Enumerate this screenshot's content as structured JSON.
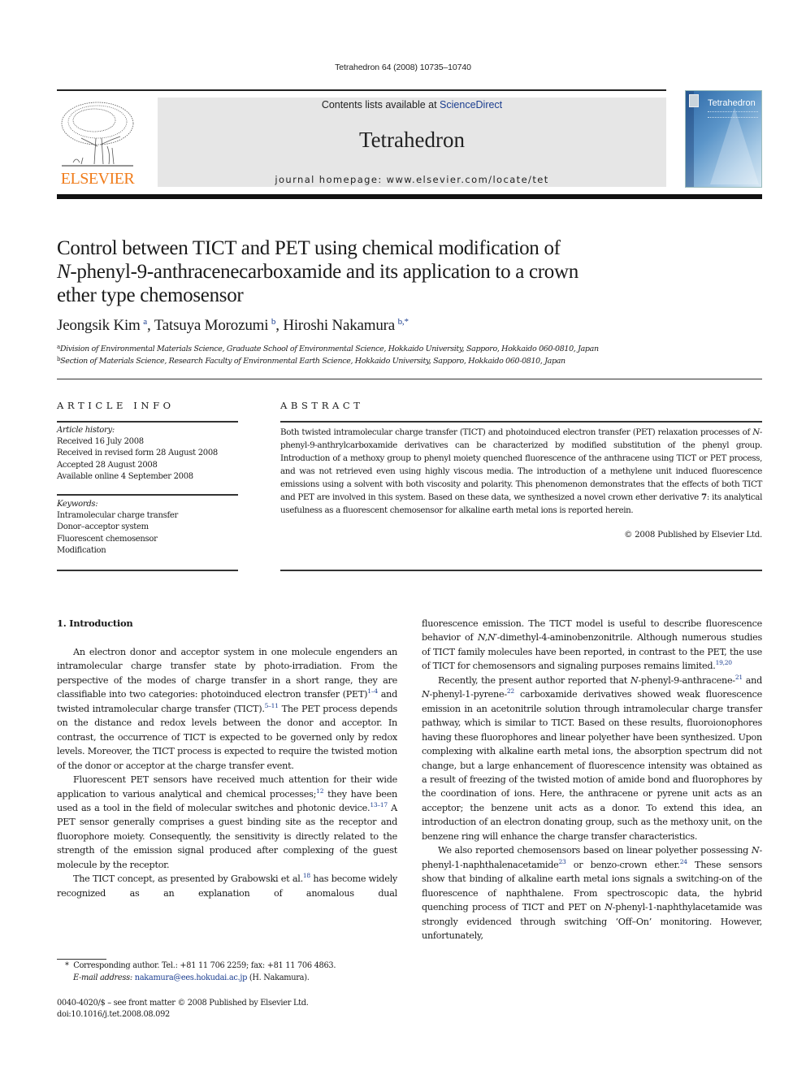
{
  "header": {
    "citation": "Tetrahedron 64 (2008) 10735–10740",
    "publisher_logo_text": "ELSEVIER",
    "contents_prefix": "Contents lists available at ",
    "contents_link": "ScienceDirect",
    "journal_title": "Tetrahedron",
    "homepage": "journal homepage: www.elsevier.com/locate/tet",
    "cover_title": "Tetrahedron"
  },
  "article": {
    "title_line1": "Control between TICT and PET using chemical modification of",
    "title_line2_italic": "N",
    "title_line2_rest": "-phenyl-9-anthracenecarboxamide and its application to a crown",
    "title_line3": "ether type chemosensor",
    "authors": [
      {
        "name": "Jeongsik Kim",
        "sup": "a"
      },
      {
        "name": "Tatsuya Morozumi",
        "sup": "b"
      },
      {
        "name": "Hiroshi Nakamura",
        "sup": "b,*"
      }
    ],
    "affiliations": [
      {
        "mark": "a",
        "text": "Division of Environmental Materials Science, Graduate School of Environmental Science, Hokkaido University, Sapporo, Hokkaido 060-0810, Japan"
      },
      {
        "mark": "b",
        "text": "Section of Materials Science, Research Faculty of Environmental Earth Science, Hokkaido University, Sapporo, Hokkaido 060-0810, Japan"
      }
    ]
  },
  "article_info": {
    "heading": "ARTICLE INFO",
    "history_label": "Article history:",
    "history": [
      "Received 16 July 2008",
      "Received in revised form 28 August 2008",
      "Accepted 28 August 2008",
      "Available online 4 September 2008"
    ],
    "keywords_label": "Keywords:",
    "keywords": [
      "Intramolecular charge transfer",
      "Donor–acceptor system",
      "Fluorescent chemosensor",
      "Modification"
    ]
  },
  "abstract": {
    "heading": "ABSTRACT",
    "p1": "Both twisted intramolecular charge transfer (TICT) and photoinduced electron transfer (PET) relaxation processes of ",
    "p1_italic": "N",
    "p2": "-phenyl-9-anthrylcarboxamide derivatives can be characterized by modified substitution of the phenyl group. Introduction of a methoxy group to phenyl moiety quenched fluorescence of the anthracene using TICT or PET process, and was not retrieved even using highly viscous media. The introduction of a methylene unit induced fluorescence emissions using a solvent with both viscosity and polarity. This phenomenon demonstrates that the effects of both TICT and PET are involved in this system. Based on these data, we synthesized a novel crown ether derivative ",
    "p2_bold": "7",
    "p3": ": its analytical usefulness as a fluorescent chemosensor for alkaline earth metal ions is reported herein.",
    "copyright": "© 2008 Published by Elsevier Ltd."
  },
  "introduction": {
    "heading": "1.  Introduction",
    "left": {
      "para1_a": "An electron donor and acceptor system in one molecule engenders an intramolecular charge transfer state by photo-irradiation. From the perspective of the modes of charge transfer in a short range, they are classifiable into two categories: photoinduced electron transfer (PET)",
      "para1_ref1": "1–4",
      "para1_b": " and twisted intramolecular charge transfer (TICT).",
      "para1_ref2": "5–11",
      "para1_c": " The PET process depends on the distance and redox levels between the donor and acceptor. In contrast, the occurrence of TICT is expected to be governed only by redox levels. Moreover, the TICT process is expected to require the twisted motion of the donor or acceptor at the charge transfer event.",
      "para2_a": "Fluorescent PET sensors have received much attention for their wide application to various analytical and chemical processes;",
      "para2_ref1": "12",
      "para2_b": " they have been used as a tool in the field of molecular switches and photonic device.",
      "para2_ref2": "13–17",
      "para2_c": " A PET sensor generally comprises a guest binding site as the receptor and fluorophore moiety. Consequently, the sensitivity is directly related to the strength of the emission signal produced after complexing of the guest molecule by the receptor.",
      "para3_a": "The TICT concept, as presented by Grabowski et al.",
      "para3_ref": "18",
      "para3_b": " has become widely recognized as an explanation of anomalous dual"
    },
    "right": {
      "para1_a": "fluorescence emission. The TICT model is useful to describe fluorescence behavior of ",
      "para1_italic": "N,N′",
      "para1_b": "-dimethyl-4-aminobenzonitrile. Although numerous studies of TICT family molecules have been reported, in contrast to the PET, the use of TICT for chemosensors and signaling purposes remains limited.",
      "para1_ref": "19,20",
      "para2_a": "Recently, the present author reported that ",
      "para2_i1": "N",
      "para2_b": "-phenyl-9-anthracene-",
      "para2_ref1": "21",
      "para2_c": " and ",
      "para2_i2": "N",
      "para2_d": "-phenyl-1-pyrene-",
      "para2_ref2": "22",
      "para2_e": " carboxamide derivatives showed weak fluorescence emission in an acetonitrile solution through intramolecular charge transfer pathway, which is similar to TICT. Based on these results, fluoroionophores having these fluorophores and linear polyether have been synthesized. Upon complexing with alkaline earth metal ions, the absorption spectrum did not change, but a large enhancement of fluorescence intensity was obtained as a result of freezing of the twisted motion of amide bond and fluorophores by the coordination of ions. Here, the anthracene or pyrene unit acts as an acceptor; the benzene unit acts as a donor. To extend this idea, an introduction of an electron donating group, such as the methoxy unit, on the benzene ring will enhance the charge transfer characteristics.",
      "para3_a": "We also reported chemosensors based on linear polyether possessing ",
      "para3_i1": "N",
      "para3_b": "-phenyl-1-naphthalenacetamide",
      "para3_ref1": "23",
      "para3_c": " or benzo-crown ether.",
      "para3_ref2": "24",
      "para3_d": " These sensors show that binding of alkaline earth metal ions signals a switching-on of the fluorescence of naphthalene. From spectroscopic data, the hybrid quenching process of TICT and PET on ",
      "para3_i2": "N",
      "para3_e": "-phenyl-1-naphthylacetamide was strongly evidenced through switching ‘Off–On’ monitoring. However, unfortunately,"
    }
  },
  "footnotes": {
    "star": "*",
    "corresponding": "Corresponding author. Tel.: +81 11 706 2259; fax: +81 11 706 4863.",
    "email_label": "E-mail address:",
    "email": "nakamura@ees.hokudai.ac.jp",
    "email_suffix": " (H. Nakamura).",
    "issn": "0040-4020/$ – see front matter © 2008 Published by Elsevier Ltd.",
    "doi": "doi:10.1016/j.tet.2008.08.092"
  },
  "colors": {
    "elsevier_orange": "#f07c1b",
    "link_blue": "#1a3d8f",
    "banner_gray": "#e6e6e6"
  }
}
